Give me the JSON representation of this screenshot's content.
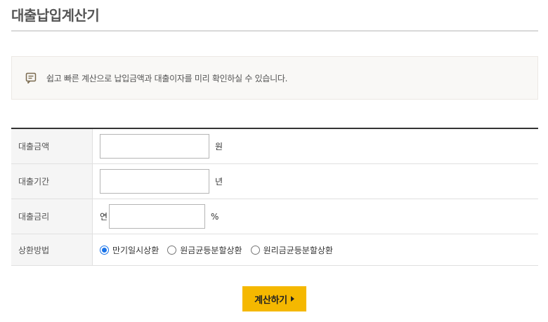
{
  "page": {
    "title": "대출납입계산기"
  },
  "notice": {
    "text": "쉽고 빠른 계산으로 납입금액과 대출이자를 미리 확인하실 수 있습니다."
  },
  "form": {
    "amount": {
      "label": "대출금액",
      "value": "",
      "unit": "원"
    },
    "period": {
      "label": "대출기간",
      "value": "",
      "unit": "년"
    },
    "rate": {
      "label": "대출금리",
      "prefix": "연",
      "value": "",
      "unit": "%"
    },
    "method": {
      "label": "상환방법",
      "options": [
        {
          "label": "만기일시상환",
          "checked": true
        },
        {
          "label": "원금균등분할상환",
          "checked": false
        },
        {
          "label": "원리금균등분할상환",
          "checked": false
        }
      ]
    }
  },
  "actions": {
    "calculate_label": "계산하기"
  },
  "colors": {
    "accent": "#f5b800",
    "radio_checked": "#1a73e8"
  }
}
